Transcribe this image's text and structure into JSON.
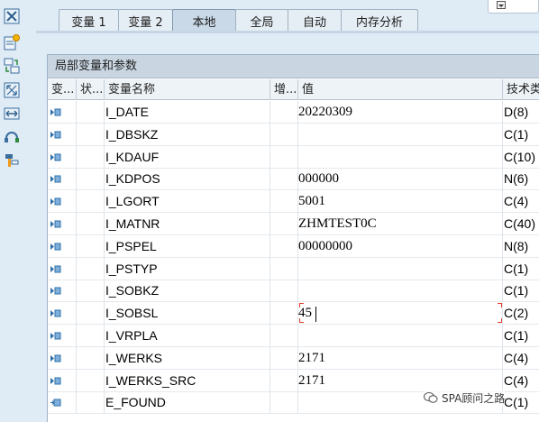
{
  "tabs": [
    {
      "label": "变量 1",
      "active": false
    },
    {
      "label": "变量 2",
      "active": false
    },
    {
      "label": "本地",
      "active": true
    },
    {
      "label": "全局",
      "active": false
    },
    {
      "label": "自动",
      "active": false
    },
    {
      "label": "内存分析",
      "active": false
    }
  ],
  "left_toolbar": {
    "icons": [
      "close-all-icon",
      "new-watchpoint-icon",
      "variable-swap-icon",
      "fullscreen-icon",
      "column-width-icon",
      "refresh-icon",
      "settings-tool-icon"
    ]
  },
  "panel": {
    "title": "局部变量和参数",
    "columns": {
      "select": "变...",
      "status": "状...",
      "name": "变量名称",
      "increment": "增...",
      "value": "值",
      "tech_type": "技术类"
    }
  },
  "rows": [
    {
      "name": "I_DATE",
      "value": "20220309",
      "type": "D(8)"
    },
    {
      "name": "I_DBSKZ",
      "value": "",
      "type": "C(1)"
    },
    {
      "name": "I_KDAUF",
      "value": "",
      "type": "C(10)"
    },
    {
      "name": "I_KDPOS",
      "value": "000000",
      "type": "N(6)"
    },
    {
      "name": "I_LGORT",
      "value": "5001",
      "type": "C(4)"
    },
    {
      "name": "I_MATNR",
      "value": "ZHMTEST0C",
      "type": "C(40)"
    },
    {
      "name": "I_PSPEL",
      "value": "00000000",
      "type": "N(8)"
    },
    {
      "name": "I_PSTYP",
      "value": "",
      "type": "C(1)"
    },
    {
      "name": "I_SOBKZ",
      "value": "",
      "type": "C(1)"
    },
    {
      "name": "I_SOBSL",
      "value": "45",
      "type": "C(2)",
      "editing": true
    },
    {
      "name": "I_VRPLA",
      "value": "",
      "type": "C(1)"
    },
    {
      "name": "I_WERKS",
      "value": "2171",
      "type": "C(4)"
    },
    {
      "name": "I_WERKS_SRC",
      "value": "2171",
      "type": "C(4)"
    },
    {
      "name": "E_FOUND",
      "value": "",
      "type": "C(1)",
      "export": true
    }
  ],
  "watermark": "SPA顾问之路",
  "colors": {
    "background": "#dfebf5",
    "tab_active": "#c9d9e8",
    "panel_title": "#c9d6e2",
    "edit_marker": "#e23a2a",
    "row_icon": "#2f6fa8"
  }
}
